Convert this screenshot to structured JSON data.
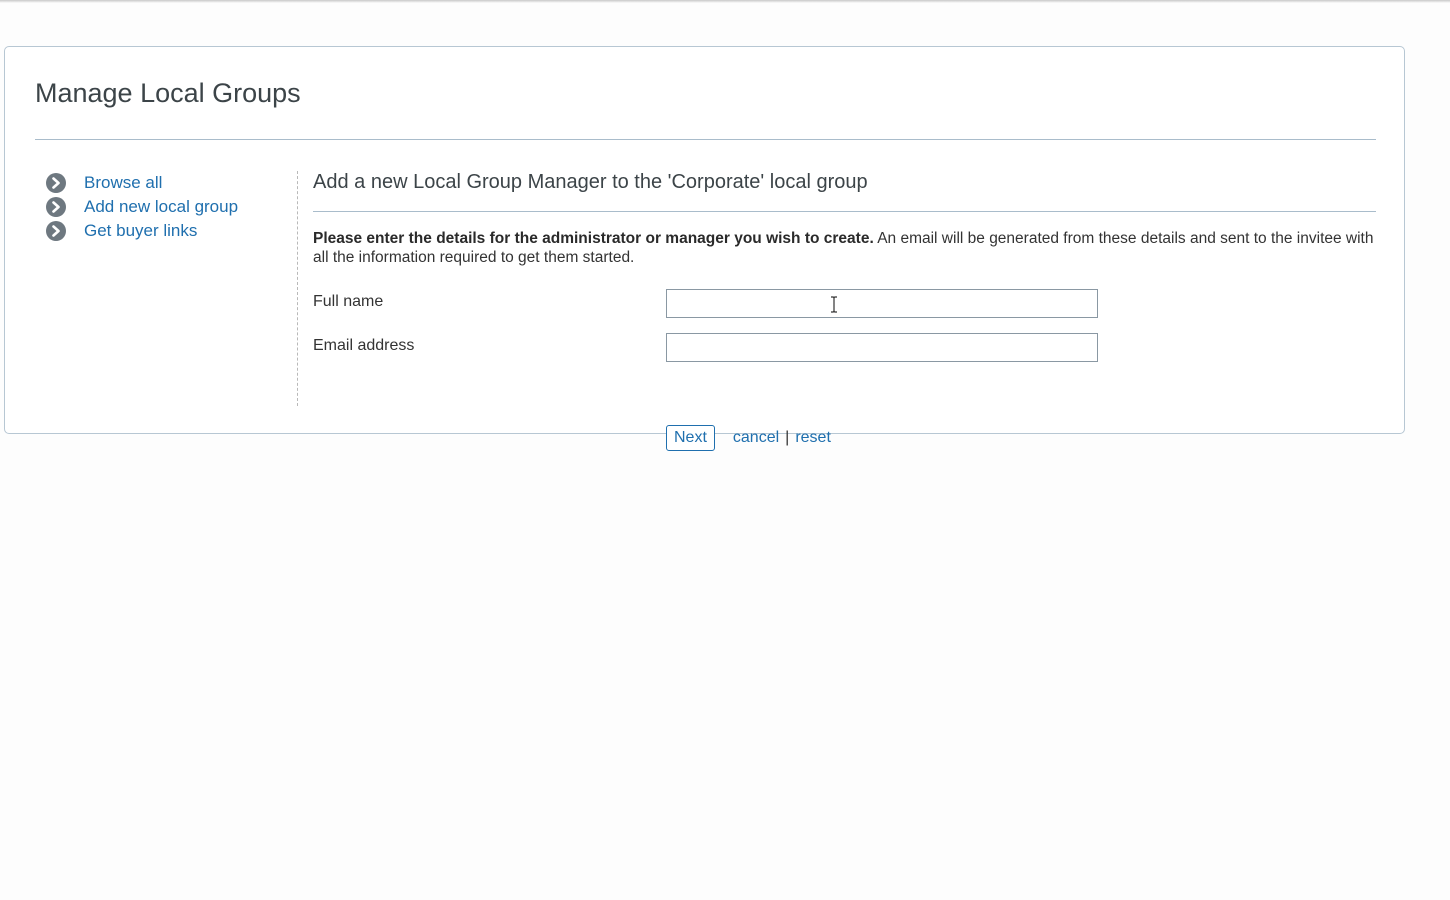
{
  "page": {
    "title": "Manage Local Groups"
  },
  "sidebar": {
    "items": [
      {
        "label": "Browse all",
        "icon": "chevron-circle-right-icon"
      },
      {
        "label": "Add new local group",
        "icon": "chevron-circle-right-icon"
      },
      {
        "label": "Get buyer links",
        "icon": "chevron-circle-right-icon"
      }
    ]
  },
  "main": {
    "section_title": "Add a new Local Group Manager to the 'Corporate' local group",
    "intro_bold": "Please enter the details for the administrator or manager you wish to create.",
    "intro_text": " An email will be generated from these details and sent to the invitee with all the information required to get them started.",
    "form": {
      "full_name_label": "Full name",
      "full_name_value": "",
      "email_label": "Email address",
      "email_value": ""
    },
    "actions": {
      "next_label": "Next",
      "cancel_label": "cancel",
      "separator": "|",
      "reset_label": "reset"
    }
  },
  "colors": {
    "link": "#1f6fae",
    "icon_bg": "#6e7880",
    "border": "#b7c7d3",
    "heading": "#3c4448"
  }
}
